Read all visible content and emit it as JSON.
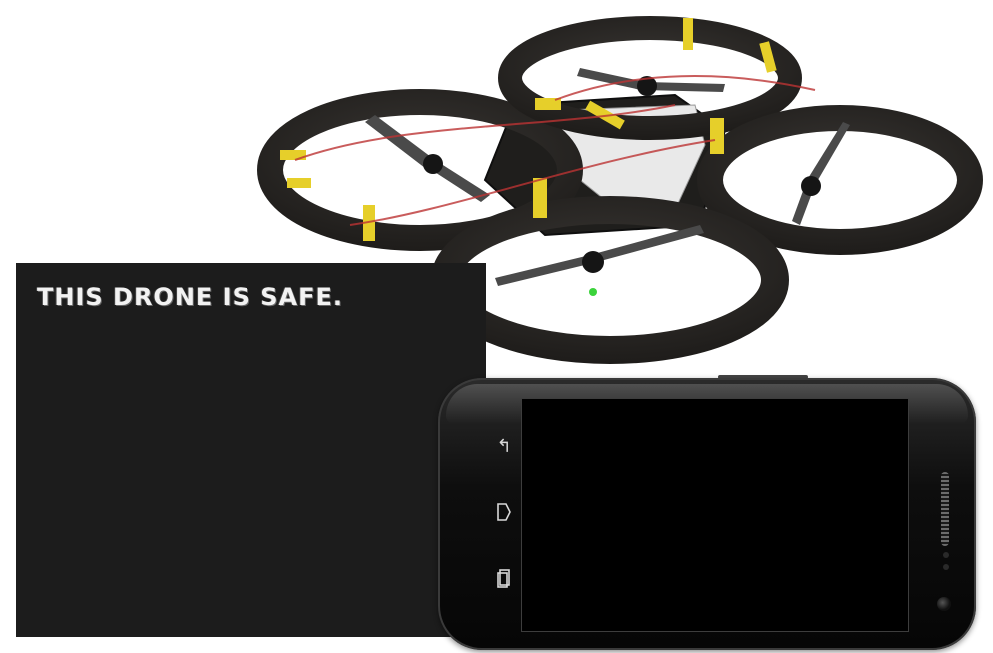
{
  "terminal": {
    "text": "THIS DRONE IS SAFE."
  },
  "phone": {
    "nav_icons": [
      "back-icon",
      "home-icon",
      "recent-apps-icon"
    ]
  },
  "colors": {
    "terminal_background": "#1c1c1c",
    "drone_foam": "#2a2826",
    "tape": "#e6cf2a"
  }
}
